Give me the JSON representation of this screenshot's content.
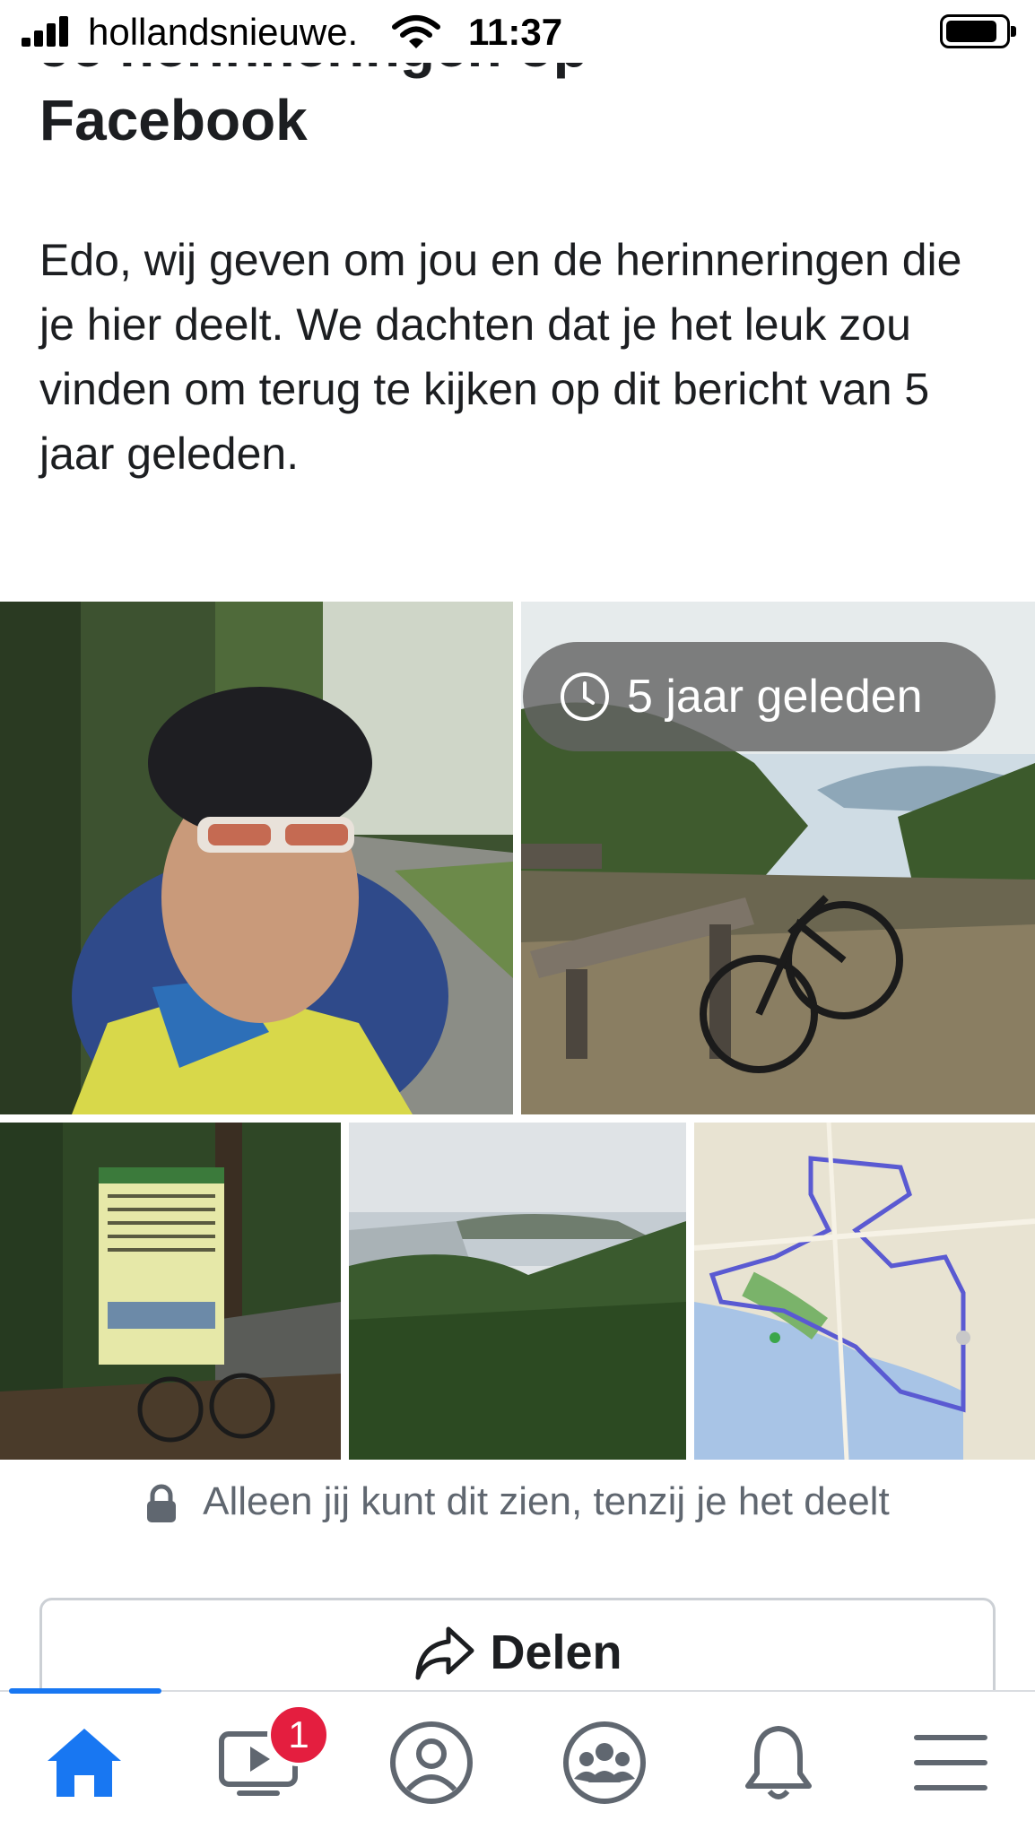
{
  "status_bar": {
    "carrier": "hollandsnieuwe.",
    "time": "11:37"
  },
  "memory": {
    "title_line1": "Je herinneringen op",
    "title_line2": "Facebook",
    "message": "Edo,  wij geven om jou en de herinneringen die je hier deelt. We dachten dat je het leuk zou vinden om terug te kijken op dit bericht van 5 jaar geleden.",
    "badge": "5 jaar geleden",
    "privacy_note": "Alleen jij kunt dit zien, tenzij je het deelt",
    "share_label": "Delen"
  },
  "tab_bar": {
    "notification_count": "1",
    "active_tab": "home",
    "accent_color": "#1877f2"
  },
  "photos": [
    "selfie-cyclist-photo",
    "bike-at-bench-lake-view-photo",
    "farm-sign-il-monterosso-photo",
    "lake-view-photo",
    "route-map-photo"
  ]
}
